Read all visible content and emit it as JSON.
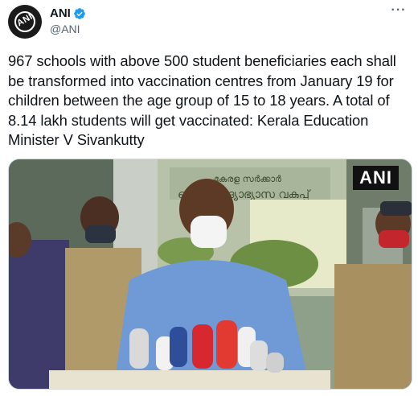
{
  "account": {
    "display_name": "ANI",
    "handle": "@ANI",
    "avatar_text": "ANI",
    "verified": true
  },
  "menu": {
    "more_label": "···"
  },
  "tweet": {
    "text": "967 schools with above 500 student beneficiaries each shall be transformed into vaccination centres from January 19 for children between the age group of 15 to 18 years. A total of 8.14 lakh students will get vaccinated: Kerala Education Minister V Sivankutty"
  },
  "media": {
    "watermark": "ANI",
    "sign_text": "കേരള സർക്കാർ",
    "sign_text_2": "പൊതു വിദ്യാഭ്യാസ വകുപ്പ്"
  },
  "colors": {
    "verified_blue": "#1d9bf0",
    "handle_gray": "#536471"
  }
}
